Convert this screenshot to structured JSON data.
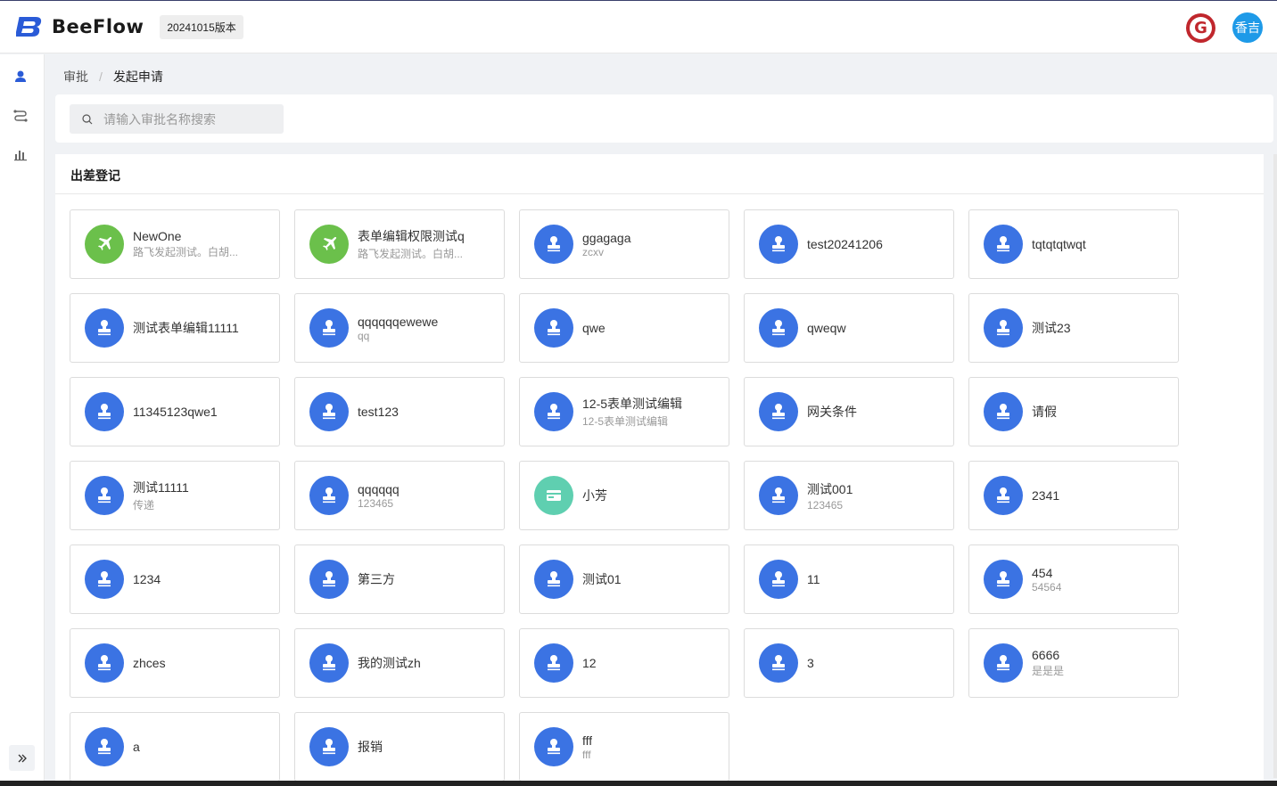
{
  "header": {
    "app_name": "BeeFlow",
    "version": "20241015版本",
    "g_letter": "G",
    "user_name": "香吉"
  },
  "breadcrumb": {
    "root": "审批",
    "separator": "/",
    "current": "发起申请"
  },
  "search": {
    "placeholder": "请输入审批名称搜索",
    "value": ""
  },
  "section": {
    "title": "出差登记"
  },
  "sidebar": {
    "icons": [
      "user-icon",
      "flow-icon",
      "chart-icon"
    ],
    "collapse_icon": "double-chevron-right-icon"
  },
  "colors": {
    "blue_icon": "#3b73e3",
    "green_icon": "#6bc04b",
    "teal_icon": "#5fcfb0",
    "avatar": "#1e9ae8",
    "brand_g": "#c0272d"
  },
  "cards": [
    {
      "title": "NewOne",
      "sub": "路飞发起测试。白胡...",
      "icon": "plane-icon",
      "color": "green"
    },
    {
      "title": "表单编辑权限测试q",
      "sub": "路飞发起测试。白胡...",
      "icon": "plane-icon",
      "color": "green"
    },
    {
      "title": "ggagaga",
      "sub": "zcxv",
      "icon": "stamp-icon",
      "color": "blue"
    },
    {
      "title": "test20241206",
      "sub": "",
      "icon": "stamp-icon",
      "color": "blue"
    },
    {
      "title": "tqtqtqtwqt",
      "sub": "",
      "icon": "stamp-icon",
      "color": "blue"
    },
    {
      "title": "测试表单编辑11111",
      "sub": "",
      "icon": "stamp-icon",
      "color": "blue"
    },
    {
      "title": "qqqqqqewewe",
      "sub": "qq",
      "icon": "stamp-icon",
      "color": "blue"
    },
    {
      "title": "qwe",
      "sub": "",
      "icon": "stamp-icon",
      "color": "blue"
    },
    {
      "title": "qweqw",
      "sub": "",
      "icon": "stamp-icon",
      "color": "blue"
    },
    {
      "title": "测试23",
      "sub": "",
      "icon": "stamp-icon",
      "color": "blue"
    },
    {
      "title": "11345123qwe1",
      "sub": "",
      "icon": "stamp-icon",
      "color": "blue"
    },
    {
      "title": "test123",
      "sub": "",
      "icon": "stamp-icon",
      "color": "blue"
    },
    {
      "title": "12-5表单测试编辑",
      "sub": "12-5表单测试编辑",
      "icon": "stamp-icon",
      "color": "blue"
    },
    {
      "title": "网关条件",
      "sub": "",
      "icon": "stamp-icon",
      "color": "blue"
    },
    {
      "title": "请假",
      "sub": "",
      "icon": "stamp-icon",
      "color": "blue"
    },
    {
      "title": "测试11111",
      "sub": "传递",
      "icon": "stamp-icon",
      "color": "blue"
    },
    {
      "title": "qqqqqq",
      "sub": "123465",
      "icon": "stamp-icon",
      "color": "blue"
    },
    {
      "title": "小芳",
      "sub": "",
      "icon": "card-icon",
      "color": "teal"
    },
    {
      "title": "测试001",
      "sub": "123465",
      "icon": "stamp-icon",
      "color": "blue"
    },
    {
      "title": "2341",
      "sub": "",
      "icon": "stamp-icon",
      "color": "blue"
    },
    {
      "title": "1234",
      "sub": "",
      "icon": "stamp-icon",
      "color": "blue"
    },
    {
      "title": "第三方",
      "sub": "",
      "icon": "stamp-icon",
      "color": "blue"
    },
    {
      "title": "测试01",
      "sub": "",
      "icon": "stamp-icon",
      "color": "blue"
    },
    {
      "title": "11",
      "sub": "",
      "icon": "stamp-icon",
      "color": "blue"
    },
    {
      "title": "454",
      "sub": "54564",
      "icon": "stamp-icon",
      "color": "blue"
    },
    {
      "title": "zhces",
      "sub": "",
      "icon": "stamp-icon",
      "color": "blue"
    },
    {
      "title": "我的测试zh",
      "sub": "",
      "icon": "stamp-icon",
      "color": "blue"
    },
    {
      "title": "12",
      "sub": "",
      "icon": "stamp-icon",
      "color": "blue"
    },
    {
      "title": "3",
      "sub": "",
      "icon": "stamp-icon",
      "color": "blue"
    },
    {
      "title": "6666",
      "sub": "是是是",
      "icon": "stamp-icon",
      "color": "blue"
    },
    {
      "title": "a",
      "sub": "",
      "icon": "stamp-icon",
      "color": "blue"
    },
    {
      "title": "报销",
      "sub": "",
      "icon": "stamp-icon",
      "color": "blue"
    },
    {
      "title": "fff",
      "sub": "fff",
      "icon": "stamp-icon",
      "color": "blue"
    }
  ]
}
